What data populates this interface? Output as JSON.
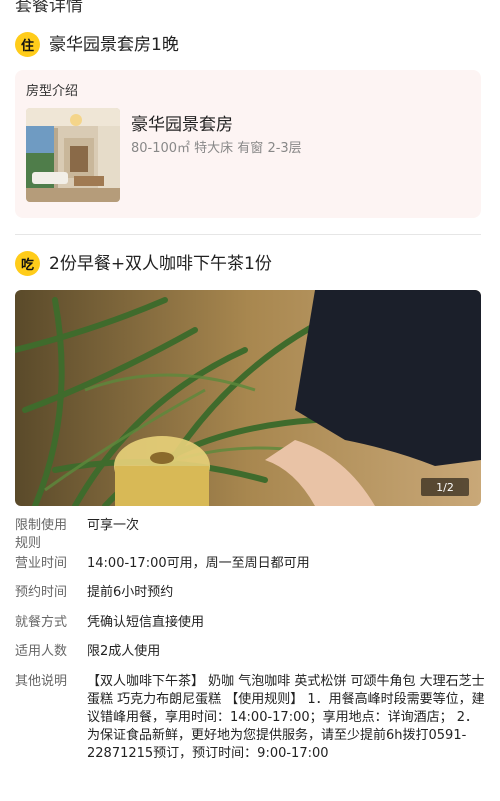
{
  "page_title": "套餐详情",
  "stay": {
    "badge": "住",
    "title": "豪华园景套房1晚",
    "card_label": "房型介绍",
    "room_name": "豪华园景套房",
    "room_specs": "80-100㎡  特大床  有窗  2-3层"
  },
  "dining": {
    "badge": "吃",
    "title": "2份早餐+双人咖啡下午茶1份",
    "photo_counter": "1/2"
  },
  "details": [
    {
      "label": "限制使用规则",
      "value": "可享一次"
    },
    {
      "label": "营业时间",
      "value": "14:00-17:00可用，周一至周日都可用"
    },
    {
      "label": "预约时间",
      "value": "提前6小时预约"
    },
    {
      "label": "就餐方式",
      "value": "凭确认短信直接使用"
    },
    {
      "label": "适用人数",
      "value": "限2成人使用"
    },
    {
      "label": "其他说明",
      "value": "【双人咖啡下午茶】 奶咖 气泡咖啡 英式松饼 可颂牛角包 大理石芝士蛋糕 巧克力布朗尼蛋糕 【使用规则】 1．用餐高峰时段需要等位，建议错峰用餐，享用时间：14:00-17:00；享用地点：详询酒店； 2．为保证食品新鲜，更好地为您提供服务，请至少提前6h拨打0591-22871215预订，预订时间：9:00-17:00"
    }
  ]
}
